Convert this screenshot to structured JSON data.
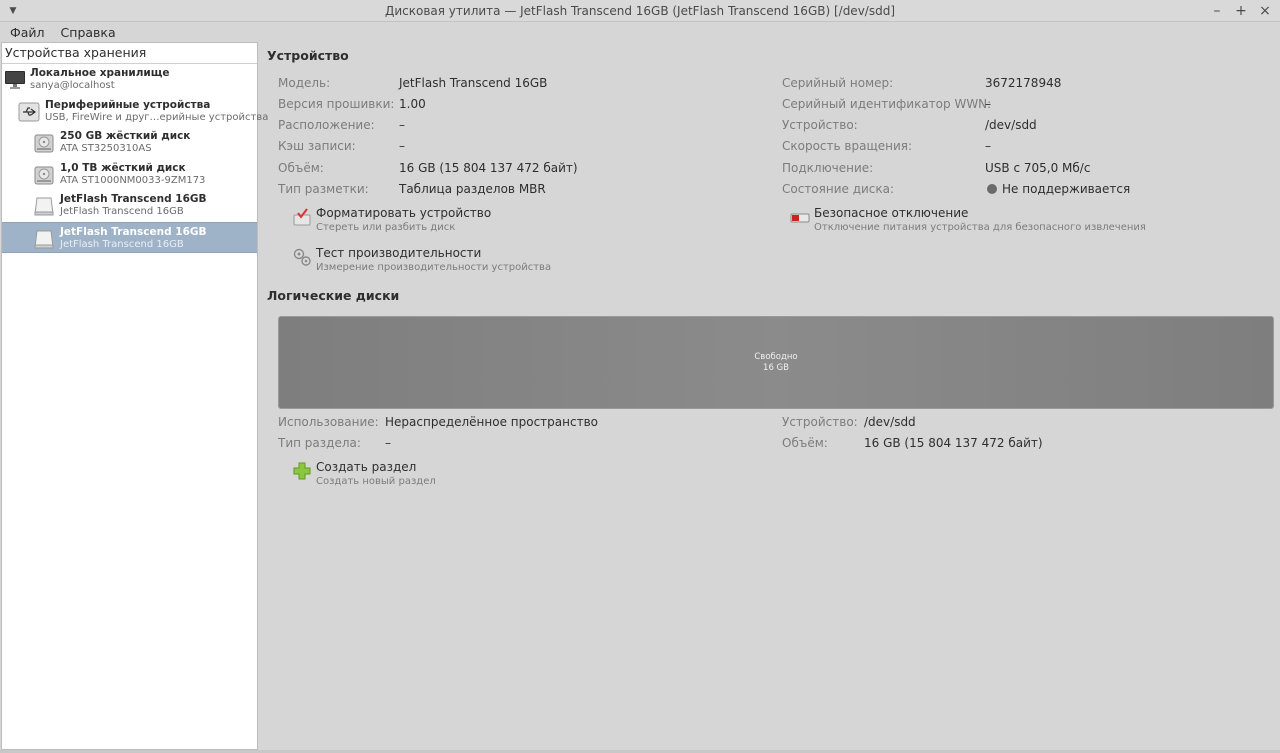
{
  "window": {
    "title": "Дисковая утилита — JetFlash Transcend 16GB (JetFlash Transcend 16GB) [/dev/sdd]"
  },
  "menubar": {
    "items": [
      "Файл",
      "Справка"
    ]
  },
  "sidebar": {
    "header": "Устройства хранения",
    "items": [
      {
        "title": "Локальное хранилище",
        "subtitle": "sanya@localhost",
        "icon": "computer-icon"
      },
      {
        "title": "Периферийные устройства",
        "subtitle": "USB, FireWire и друг…ерийные устройства",
        "icon": "usb-icon"
      },
      {
        "title": "250 GB жёсткий диск",
        "subtitle": "ATA ST3250310AS",
        "icon": "harddisk-icon"
      },
      {
        "title": "1,0 TB жёсткий диск",
        "subtitle": "ATA ST1000NM0033-9ZM173",
        "icon": "harddisk-icon"
      },
      {
        "title": "JetFlash Transcend 16GB",
        "subtitle": "JetFlash Transcend 16GB",
        "icon": "flashdrive-icon"
      },
      {
        "title": "JetFlash Transcend 16GB",
        "subtitle": "JetFlash Transcend 16GB",
        "icon": "flashdrive-icon",
        "selected": true
      }
    ]
  },
  "device": {
    "section_title": "Устройство",
    "left": [
      {
        "label": "Модель:",
        "value": "JetFlash Transcend 16GB"
      },
      {
        "label": "Версия прошивки:",
        "value": "1.00"
      },
      {
        "label": "Расположение:",
        "value": "–"
      },
      {
        "label": "Кэш записи:",
        "value": "–"
      },
      {
        "label": "Объём:",
        "value": "16 GB (15 804 137 472 байт)"
      },
      {
        "label": "Тип разметки:",
        "value": "Таблица разделов MBR"
      }
    ],
    "right": [
      {
        "label": "Серийный номер:",
        "value": "3672178948"
      },
      {
        "label": "Серийный идентификатор WWN:",
        "value": "–"
      },
      {
        "label": "Устройство:",
        "value": "/dev/sdd"
      },
      {
        "label": "Скорость вращения:",
        "value": "–"
      },
      {
        "label": "Подключение:",
        "value": "USB с 705,0 Мб/с"
      },
      {
        "label": "Состояние диска:",
        "value": "Не поддерживается"
      }
    ],
    "actions": {
      "format": {
        "title": "Форматировать устройство",
        "subtitle": "Стереть или разбить диск"
      },
      "benchmark": {
        "title": "Тест производительности",
        "subtitle": "Измерение производительности устройства"
      },
      "eject": {
        "title": "Безопасное отключение",
        "subtitle": "Отключение питания устройства для безопасного извлечения"
      }
    }
  },
  "volumes": {
    "section_title": "Логические диски",
    "bar": {
      "label": "Свободно",
      "size": "16 GB"
    },
    "left": [
      {
        "label": "Использование:",
        "value": "Нераспределённое пространство"
      },
      {
        "label": "Тип раздела:",
        "value": "–"
      }
    ],
    "right": [
      {
        "label": "Устройство:",
        "value": "/dev/sdd"
      },
      {
        "label": "Объём:",
        "value": "16 GB (15 804 137 472 байт)"
      }
    ],
    "actions": {
      "create": {
        "title": "Создать раздел",
        "subtitle": "Создать новый раздел"
      }
    }
  }
}
